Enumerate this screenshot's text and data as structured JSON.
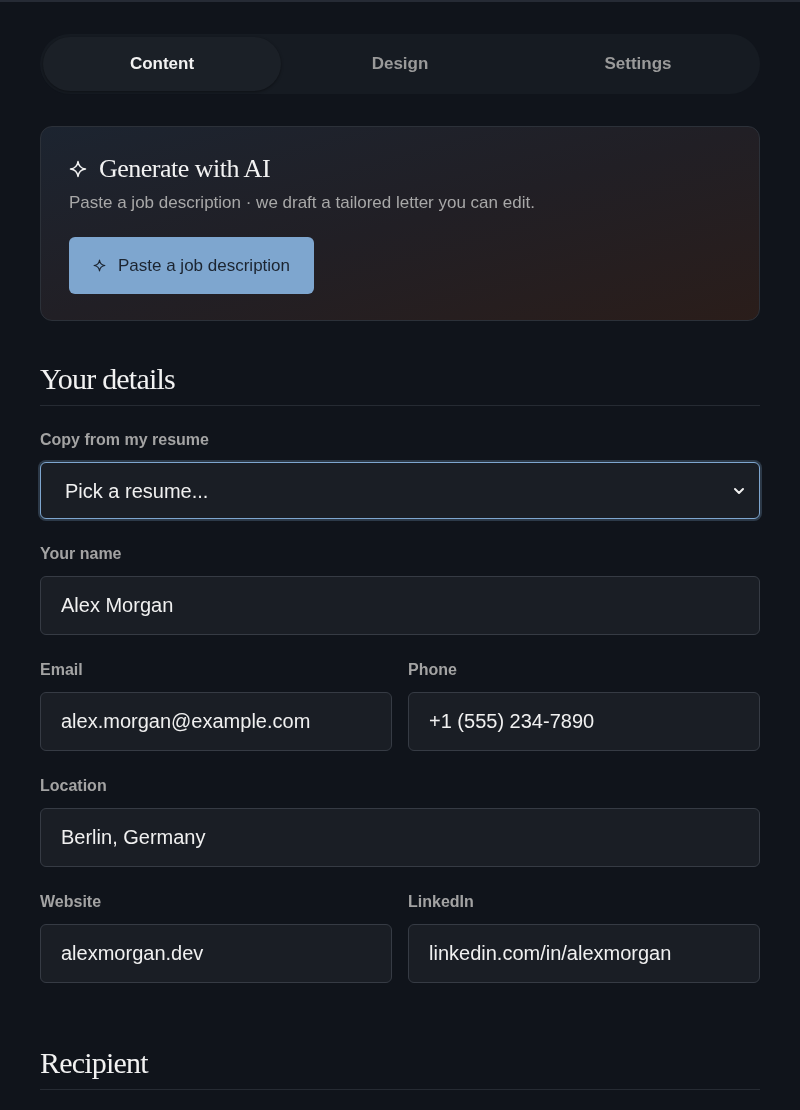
{
  "tabs": [
    {
      "label": "Content",
      "selected": true
    },
    {
      "label": "Design",
      "selected": false
    },
    {
      "label": "Settings",
      "selected": false
    }
  ],
  "ai_card": {
    "title": "Generate with AI",
    "description": "Paste a job description · we draft a tailored letter you can edit.",
    "button": "Paste a job description"
  },
  "your_details": {
    "title": "Your details",
    "rows": [
      [
        {
          "kind": "select",
          "label": "Copy from my resume",
          "value": "Pick a resume...",
          "focused": true
        }
      ],
      [
        {
          "kind": "text",
          "label": "Your name",
          "value": "Alex Morgan",
          "focused": false
        }
      ],
      [
        {
          "kind": "text",
          "label": "Email",
          "value": "alex.morgan@example.com",
          "focused": false
        },
        {
          "kind": "text",
          "label": "Phone",
          "value": "+1 (555) 234-7890",
          "focused": false
        }
      ],
      [
        {
          "kind": "text",
          "label": "Location",
          "value": "Berlin, Germany",
          "focused": false
        }
      ],
      [
        {
          "kind": "text",
          "label": "Website",
          "value": "alexmorgan.dev",
          "focused": false
        },
        {
          "kind": "text",
          "label": "LinkedIn",
          "value": "linkedin.com/in/alexmorgan",
          "focused": false
        }
      ]
    ]
  },
  "recipient": {
    "title": "Recipient"
  }
}
